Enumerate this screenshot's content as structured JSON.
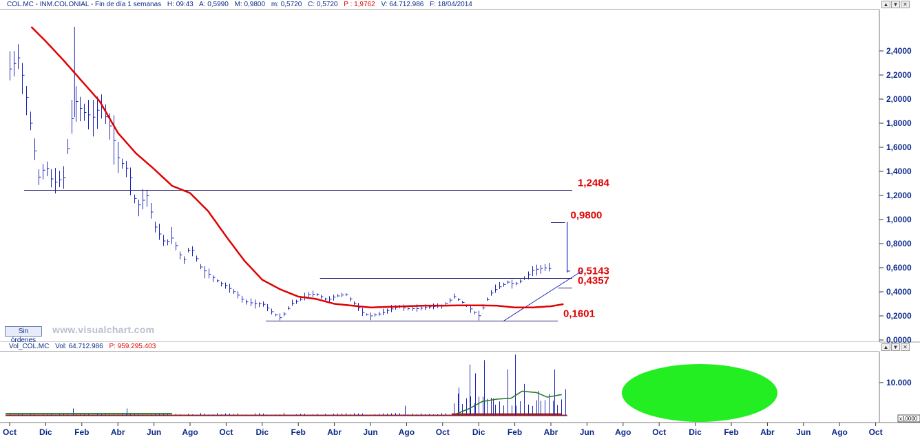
{
  "header": {
    "symbol": "COL.MC - INM.COLONIAL - Fin de día 1 semanas",
    "high": "H: 09:43",
    "open": "A: 0,5990",
    "max": "M: 0,9800",
    "close": "m: 0,5720",
    "last": "C: 0,5720",
    "p": "P : 1,9762",
    "volume": "V: 64.712.986",
    "date": "F: 18/04/2014"
  },
  "volume_header": {
    "name": "Vol_COL.MC",
    "vol": "Vol: 64.712.986",
    "p": "P: 959.295.403"
  },
  "window_controls": [
    "▲",
    "▼",
    "✕"
  ],
  "sin_ordenes": "Sin órdenes",
  "watermark": "www.visualchart.com",
  "volume_multiplier": "x10000",
  "colors": {
    "price": "#1c26b3",
    "moving_average": "#e00000",
    "level_text": "#e00000",
    "volume_highlight": "#22ee22",
    "volume_ma": "#2a7a2a",
    "axis": "#0b2a8a"
  },
  "chart_data": [
    {
      "type": "ohlc",
      "title": "COL.MC - INM.COLONIAL - Fin de día 1 semanas",
      "ylim": [
        0,
        2.6
      ],
      "y_ticks": [
        "0,0000",
        "0,2000",
        "0,4000",
        "0,6000",
        "0,8000",
        "1,0000",
        "1,2000",
        "1,4000",
        "1,6000",
        "1,8000",
        "2,0000",
        "2,2000",
        "2,4000"
      ],
      "x_tick_labels": [
        "Oct",
        "Dic",
        "Feb",
        "Abr",
        "Jun",
        "Ago",
        "Oct",
        "Dic",
        "Feb",
        "Abr",
        "Jun",
        "Ago",
        "Oct",
        "Dic",
        "Feb",
        "Abr",
        "Jun",
        "Ago",
        "Oct",
        "Dic",
        "Feb",
        "Abr",
        "Jun",
        "Ago",
        "Oct"
      ],
      "x_tick_months": [
        0,
        2,
        4,
        6,
        8,
        10,
        12,
        14,
        16,
        18,
        20,
        22,
        24,
        26,
        28,
        30,
        32,
        34,
        36,
        38,
        40,
        42,
        44,
        46,
        48
      ],
      "price_anchors_month": [
        0,
        0.5,
        1,
        1.6,
        2,
        2.4,
        3,
        3.6,
        4,
        4.6,
        5,
        5.6,
        6,
        6.6,
        7,
        7.6,
        8,
        8.6,
        9,
        9.6,
        10,
        10.6,
        11,
        11.6,
        12,
        12.6,
        13,
        13.6,
        14,
        14.6,
        15,
        15.6,
        16,
        16.6,
        17,
        17.6,
        18,
        18.6,
        19,
        19.6,
        20,
        20.6,
        21,
        21.6,
        22,
        22.6,
        23,
        23.6,
        24,
        24.6,
        25,
        25.6,
        26,
        26.6,
        27,
        27.6,
        28,
        28.6,
        29,
        29.6,
        30,
        30.4,
        30.9
      ],
      "price_anchors_value": [
        2.25,
        2.35,
        1.95,
        1.35,
        1.45,
        1.3,
        1.35,
        2.0,
        1.9,
        1.85,
        1.95,
        1.75,
        1.5,
        1.4,
        1.1,
        1.2,
        0.95,
        0.8,
        0.85,
        0.65,
        0.78,
        0.6,
        0.55,
        0.48,
        0.45,
        0.38,
        0.32,
        0.3,
        0.3,
        0.22,
        0.18,
        0.3,
        0.33,
        0.38,
        0.38,
        0.33,
        0.36,
        0.38,
        0.32,
        0.22,
        0.2,
        0.22,
        0.25,
        0.28,
        0.26,
        0.26,
        0.27,
        0.28,
        0.28,
        0.36,
        0.32,
        0.25,
        0.2,
        0.38,
        0.43,
        0.48,
        0.46,
        0.52,
        0.58,
        0.6,
        0.59
      ],
      "last_bar": {
        "month": 30.9,
        "high": 0.98,
        "low": 0.56,
        "close": 0.572
      },
      "ma_anchors_month": [
        1.2,
        2,
        3,
        4,
        5,
        6,
        7,
        8,
        9,
        10,
        11,
        12,
        13,
        14,
        15,
        16,
        17,
        18,
        19,
        20,
        21,
        22,
        23,
        24,
        25,
        26,
        27,
        28,
        29,
        30,
        30.8
      ],
      "ma_anchors_value": [
        2.6,
        2.48,
        2.32,
        2.15,
        1.98,
        1.72,
        1.55,
        1.42,
        1.28,
        1.22,
        1.07,
        0.86,
        0.66,
        0.5,
        0.42,
        0.36,
        0.34,
        0.3,
        0.285,
        0.27,
        0.275,
        0.28,
        0.285,
        0.285,
        0.287,
        0.287,
        0.285,
        0.27,
        0.27,
        0.28,
        0.3
      ],
      "levels": [
        {
          "label": "1,2484",
          "value": 1.2484,
          "from_month": 0.8,
          "to_month": 35
        },
        {
          "label": "0,9800",
          "value": 0.98,
          "from_month": 30,
          "to_month": 34.6
        },
        {
          "label": "0,5143",
          "value": 0.5143,
          "from_month": 17.2,
          "to_month": 35
        },
        {
          "label": "0,4357",
          "value": 0.4357,
          "from_month": 30.4,
          "to_month": 35
        },
        {
          "label": "0,1601",
          "value": 0.1601,
          "from_month": 14.2,
          "to_month": 34.2
        }
      ],
      "trendline": {
        "from_month": 27.4,
        "from_value": 0.16,
        "to_month": 31.4,
        "to_value": 0.59
      }
    },
    {
      "type": "bar",
      "title": "Vol_COL.MC",
      "ylim": [
        0,
        14
      ],
      "y_ticks": [
        "10.000"
      ],
      "unit": "x10000",
      "spikes_month": [
        3.5,
        6.5,
        21.9,
        24.9,
        25.5,
        25.8,
        26.3,
        26.8,
        27.6,
        28,
        28.5,
        29.3,
        30.2,
        30.8
      ],
      "spikes_value": [
        2.2,
        2.2,
        3.0,
        8.5,
        15.5,
        12.8,
        16.8,
        5.2,
        14.0,
        18.5,
        9.6,
        7.5,
        14.0,
        8.0
      ],
      "ma_month": [
        24.7,
        25.5,
        26.2,
        27.0,
        27.8,
        28.4,
        29.2,
        29.8,
        30.6
      ],
      "ma_value": [
        0.4,
        2.2,
        4.3,
        5.0,
        5.3,
        7.4,
        7.0,
        5.6,
        6.4
      ]
    }
  ]
}
